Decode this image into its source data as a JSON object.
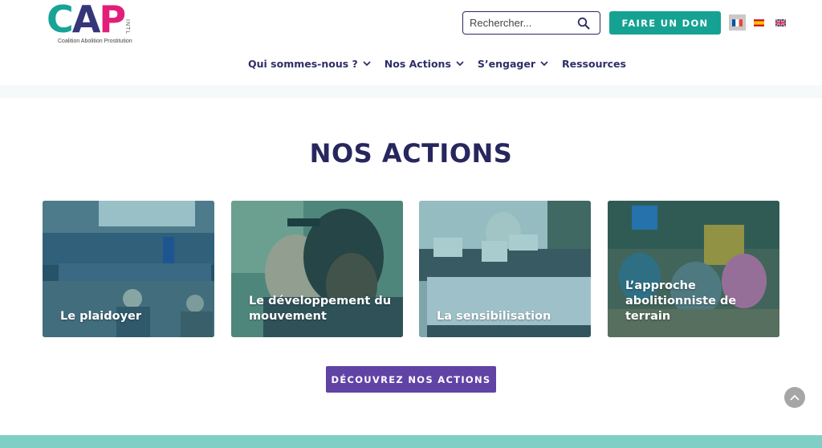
{
  "logo": {
    "letters": [
      "C",
      "A",
      "P"
    ],
    "intl": "INTL",
    "tagline": "Coalition Abolition Prostitution"
  },
  "search": {
    "placeholder": "Rechercher..."
  },
  "donate_label": "FAIRE UN DON",
  "languages": [
    {
      "code": "fr",
      "icon": "flag-fr-icon",
      "active": true
    },
    {
      "code": "es",
      "icon": "flag-es-icon",
      "active": false
    },
    {
      "code": "en",
      "icon": "flag-uk-icon",
      "active": false
    }
  ],
  "nav": [
    {
      "label": "Qui sommes-nous ?",
      "has_dropdown": true
    },
    {
      "label": "Nos Actions",
      "has_dropdown": true
    },
    {
      "label": "S’engager",
      "has_dropdown": true
    },
    {
      "label": "Ressources",
      "has_dropdown": false
    }
  ],
  "section": {
    "title": "NOS ACTIONS",
    "cards": [
      {
        "label": "Le plaidoyer"
      },
      {
        "label": "Le développement du mouvement"
      },
      {
        "label": "La sensibilisation"
      },
      {
        "label": "L’approche abolitionniste de terrain"
      }
    ],
    "cta_label": "DÉCOUVREZ NOS ACTIONS"
  },
  "colors": {
    "brand_teal": "#15a293",
    "brand_navy": "#27275e",
    "brand_pink": "#e21e7b",
    "cta_purple": "#6143a6"
  }
}
